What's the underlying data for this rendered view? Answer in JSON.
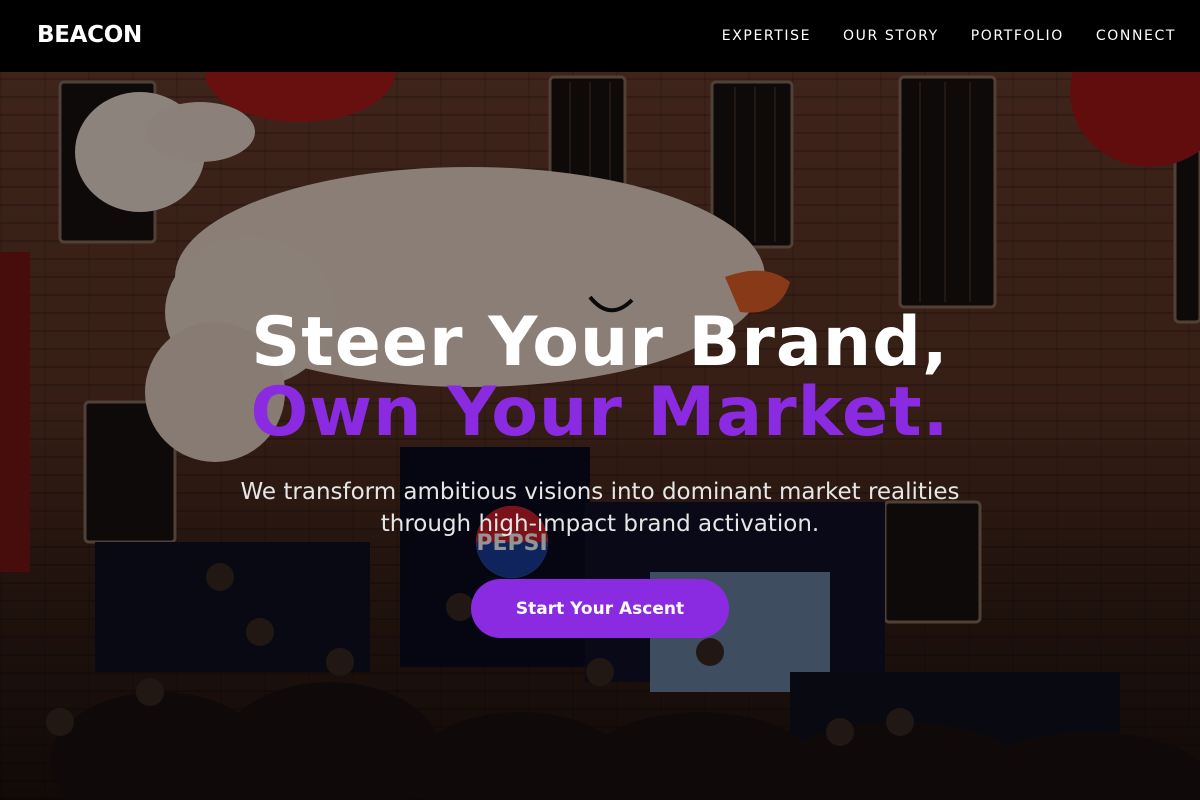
{
  "brand": {
    "name": "BEACON"
  },
  "nav": {
    "items": [
      {
        "label": "EXPERTISE"
      },
      {
        "label": "OUR STORY"
      },
      {
        "label": "PORTFOLIO"
      },
      {
        "label": "CONNECT"
      }
    ]
  },
  "hero": {
    "headline_line1": "Steer Your Brand,",
    "headline_line2": "Own Your Market.",
    "subtitle_line1": "We transform ambitious visions into dominant market realities",
    "subtitle_line2": "through high-impact brand activation.",
    "cta_label": "Start Your Ascent",
    "background_image": "event-crowd-photo",
    "booth_logo_text": "PEPSI"
  },
  "colors": {
    "accent": "#8a2be2",
    "header_bg": "#000000",
    "text": "#ffffff",
    "subtitle": "#e6e6e6"
  }
}
